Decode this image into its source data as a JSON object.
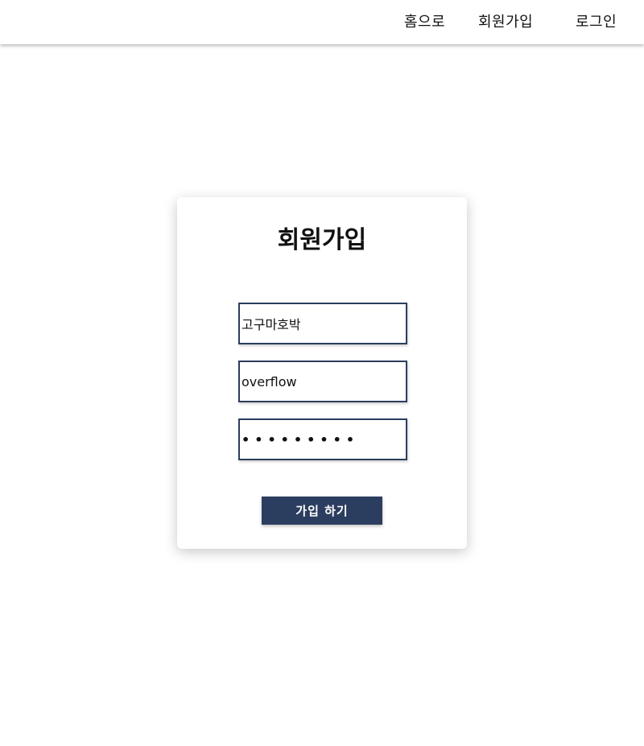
{
  "nav": {
    "home": "홈으로",
    "signup": "회원가입",
    "login": "로그인"
  },
  "form": {
    "title": "회원가입",
    "name_value": "고구마호박",
    "id_value": "overflow",
    "password_value": "•••••••••",
    "submit_label": "가입 하기"
  },
  "colors": {
    "accent": "#2c3e5f",
    "background": "#ffffff"
  }
}
